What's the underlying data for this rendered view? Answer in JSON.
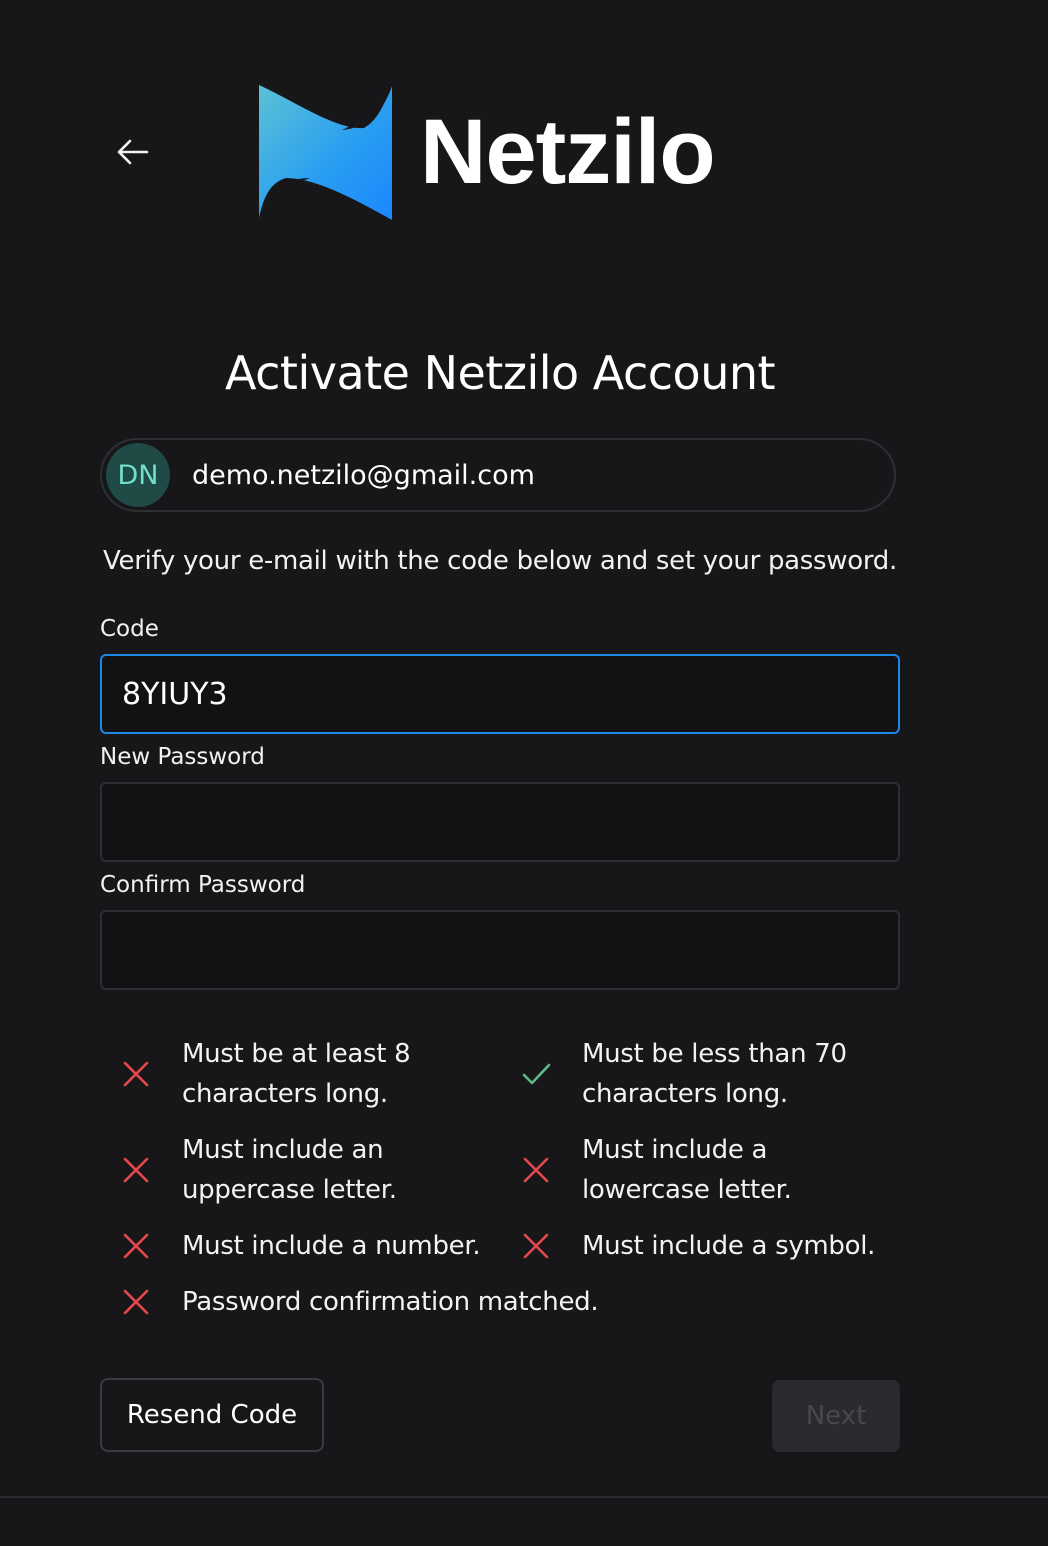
{
  "brand": {
    "name": "Netzilo"
  },
  "header": {
    "back_icon": "arrow-left-icon"
  },
  "title": "Activate Netzilo Account",
  "account": {
    "initials": "DN",
    "email": "demo.netzilo@gmail.com"
  },
  "instructions": "Verify your e-mail with the code below and set your password.",
  "form": {
    "code": {
      "label": "Code",
      "value": "8YIUY3"
    },
    "new_password": {
      "label": "New Password",
      "value": ""
    },
    "confirm_password": {
      "label": "Confirm Password",
      "value": ""
    }
  },
  "rules": [
    {
      "text": "Must be at least 8 characters long.",
      "status": "fail"
    },
    {
      "text": "Must be less than 70 characters long.",
      "status": "pass"
    },
    {
      "text": "Must include an uppercase letter.",
      "status": "fail"
    },
    {
      "text": "Must include a lowercase letter.",
      "status": "fail"
    },
    {
      "text": "Must include a number.",
      "status": "fail"
    },
    {
      "text": "Must include a symbol.",
      "status": "fail"
    },
    {
      "text": "Password confirmation matched.",
      "status": "fail"
    }
  ],
  "buttons": {
    "resend": "Resend Code",
    "next": "Next",
    "next_disabled": true
  },
  "colors": {
    "background": "#17171a",
    "accent": "#1f86ea",
    "fail": "#e5484d",
    "pass": "#5fb98a",
    "avatar_bg": "#1f4a45",
    "avatar_text": "#6fe0cc"
  }
}
